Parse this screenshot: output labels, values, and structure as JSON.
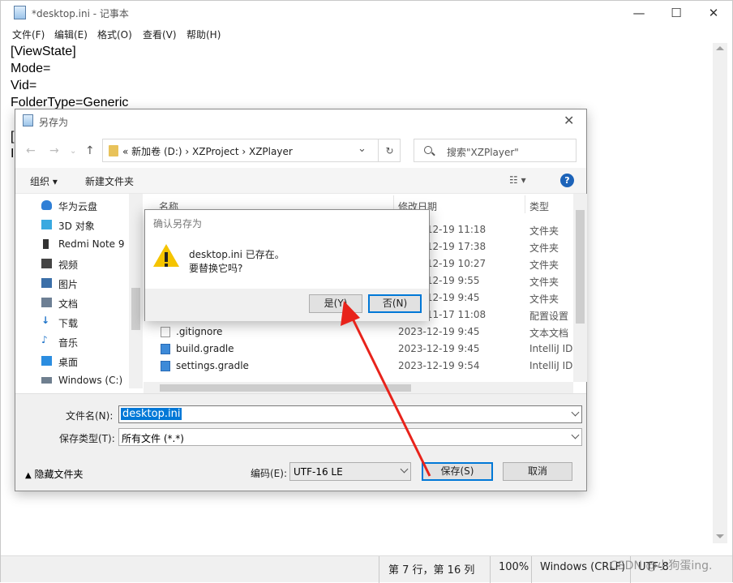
{
  "notepad": {
    "title": "*desktop.ini - 记事本",
    "menu": [
      "文件(F)",
      "编辑(E)",
      "格式(O)",
      "查看(V)",
      "帮助(H)"
    ],
    "lines": [
      "[ViewState]",
      "Mode=",
      "Vid=",
      "FolderType=Generic",
      "",
      "[.",
      "In"
    ],
    "status": {
      "position": "第 7 行，第 16 列",
      "zoom": "100%",
      "line_ending": "Windows (CRLF)",
      "encoding": "UTF-8"
    }
  },
  "save_dialog": {
    "title": "另存为",
    "breadcrumb": "«  新加卷 (D:)  ›  XZProject  ›  XZPlayer",
    "search_placeholder": "搜索\"XZPlayer\"",
    "toolbar": {
      "organize": "组织 ▾",
      "new_folder": "新建文件夹"
    },
    "nav_items": [
      {
        "label": "华为云盘",
        "icon": "cloud-icon",
        "color": "#2f7fd6"
      },
      {
        "label": "3D 对象",
        "icon": "cube-icon",
        "color": "#39a9e0"
      },
      {
        "label": "Redmi Note 9",
        "icon": "phone-icon",
        "color": "#333333"
      },
      {
        "label": "视频",
        "icon": "video-icon",
        "color": "#444444"
      },
      {
        "label": "图片",
        "icon": "picture-icon",
        "color": "#3b6fa8"
      },
      {
        "label": "文档",
        "icon": "document-icon",
        "color": "#6d7f94"
      },
      {
        "label": "下载",
        "icon": "download-icon",
        "color": "#1f74c9"
      },
      {
        "label": "音乐",
        "icon": "music-icon",
        "color": "#1f74c9"
      },
      {
        "label": "桌面",
        "icon": "desktop-icon",
        "color": "#2b8de0"
      },
      {
        "label": "Windows (C:)",
        "icon": "drive-icon",
        "color": "#6f7f8f"
      }
    ],
    "columns": {
      "name": "名称",
      "date": "修改日期",
      "type": "类型"
    },
    "rows": [
      {
        "name": "",
        "date": "2023-12-19 11:18",
        "type": "文件夹",
        "icon": "folder-icon"
      },
      {
        "name": "",
        "date": "2023-12-19 17:38",
        "type": "文件夹",
        "icon": "folder-icon"
      },
      {
        "name": "",
        "date": "2023-12-19 10:27",
        "type": "文件夹",
        "icon": "folder-icon"
      },
      {
        "name": "",
        "date": "2023-12-19 9:55",
        "type": "文件夹",
        "icon": "folder-icon"
      },
      {
        "name": "",
        "date": "2023-12-19 9:45",
        "type": "文件夹",
        "icon": "folder-icon"
      },
      {
        "name": "",
        "date": "2023-11-17 11:08",
        "type": "配置设置",
        "icon": "config-icon"
      },
      {
        "name": ".gitignore",
        "date": "2023-12-19 9:45",
        "type": "文本文档",
        "icon": "text-file-icon"
      },
      {
        "name": "build.gradle",
        "date": "2023-12-19 9:45",
        "type": "IntelliJ ID",
        "icon": "gradle-file-icon"
      },
      {
        "name": "settings.gradle",
        "date": "2023-12-19 9:54",
        "type": "IntelliJ ID",
        "icon": "gradle-file-icon"
      }
    ],
    "file_name_label": "文件名(N):",
    "file_name_value": "desktop.ini",
    "save_type_label": "保存类型(T):",
    "save_type_value": "所有文件  (*.*)",
    "hide_folders": "隐藏文件夹",
    "encoding_label": "编码(E):",
    "encoding_value": "UTF-16 LE",
    "save_button": "保存(S)",
    "cancel_button": "取消"
  },
  "confirm_dialog": {
    "title": "确认另存为",
    "message_line1": "desktop.ini 已存在。",
    "message_line2": "要替换它吗?",
    "yes_button": "是(Y)",
    "no_button": "否(N)"
  },
  "watermark": "CSDN @小狗蛋ing.",
  "colors": {
    "accent": "#0078d7",
    "arrow": "#e8231b",
    "warning": "#f5c400"
  }
}
